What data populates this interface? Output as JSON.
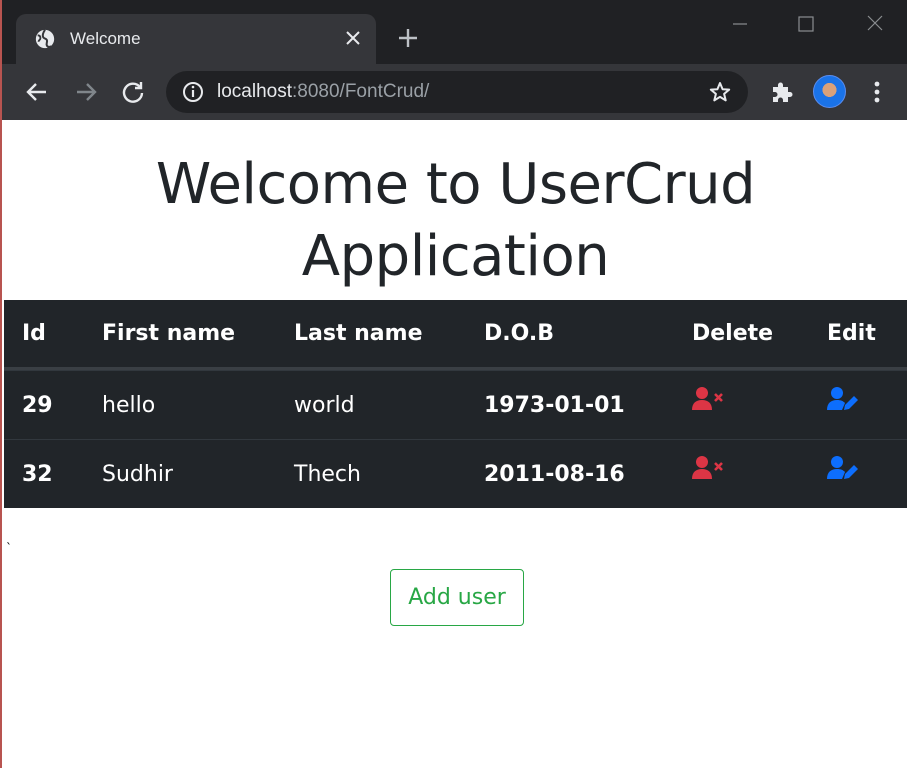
{
  "browser": {
    "tab_title": "Welcome",
    "url_host": "localhost",
    "url_rest": ":8080/FontCrud/"
  },
  "page": {
    "heading": "Welcome to UserCrud Application",
    "tick_mark": "`",
    "add_user_label": "Add user"
  },
  "table": {
    "headers": [
      "Id",
      "First name",
      "Last name",
      "D.O.B",
      "Delete",
      "Edit"
    ],
    "rows": [
      {
        "id": "29",
        "first_name": "hello",
        "last_name": "world",
        "dob": "1973-01-01"
      },
      {
        "id": "32",
        "first_name": "Sudhir",
        "last_name": "Thech",
        "dob": "2011-08-16"
      }
    ]
  },
  "icons": {
    "delete": "user-remove-icon",
    "edit": "user-edit-icon"
  },
  "colors": {
    "delete": "#dc3545",
    "edit": "#0d6efd",
    "add_button": "#28a745",
    "table_bg": "#212529"
  }
}
